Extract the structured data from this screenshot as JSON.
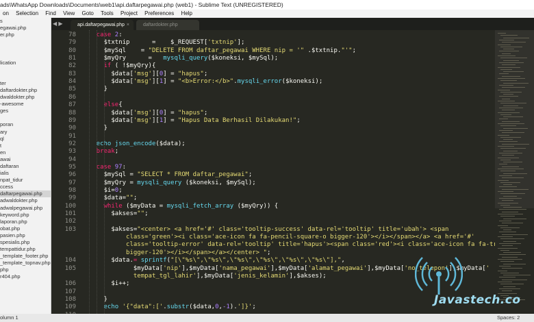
{
  "window": {
    "title": "ads\\WhatsApp Downloads\\Documents\\web1\\api.daftarpegawai.php (web1) - Sublime Text (UNREGISTERED)"
  },
  "menu": [
    "on",
    "Selection",
    "Find",
    "View",
    "Goto",
    "Tools",
    "Project",
    "Preferences",
    "Help"
  ],
  "sidebar": {
    "items": [
      "s",
      "egawai.php",
      "er.php",
      "",
      "",
      "",
      "lication",
      "",
      "",
      "ter",
      "daftardokter.php",
      "dwaldokter.php",
      "-awesome",
      "ges",
      "",
      "poran",
      "ary",
      "ql",
      "t",
      "en",
      "awai",
      "daftaran",
      "ialis",
      "npat_tidur",
      "ccess",
      "daftarpegawai.php",
      "adwaldokter.php",
      "adwalpegawai.php",
      "keyword.php",
      "laporan.php",
      "obat.php",
      "pasien.php",
      "spesialis.php",
      "tempattidur.php",
      "_template_footer.php",
      "_template_topnav.php",
      "php",
      "r404.php"
    ],
    "active_index": 25
  },
  "tabs": [
    {
      "label": "api.daftarpegawai.php",
      "active": true
    },
    {
      "label": "daftardokter.php",
      "active": false
    }
  ],
  "tab_close_glyph": "×",
  "nav_glyph": "◀ ▶",
  "code_lines": [
    {
      "num": "78",
      "indent": 2,
      "tokens": [
        [
          "k",
          "case "
        ],
        [
          "n",
          "2"
        ],
        [
          "v",
          ":"
        ]
      ]
    },
    {
      "num": "79",
      "indent": 3,
      "tokens": [
        [
          "v",
          "$txtnip      =    $_REQUEST["
        ],
        [
          "s",
          "'txtnip'"
        ],
        [
          "v",
          "];"
        ]
      ]
    },
    {
      "num": "80",
      "indent": 3,
      "tokens": [
        [
          "v",
          "$mySql    = "
        ],
        [
          "s",
          "\"DELETE FROM daftar_pegawai WHERE nip = '\""
        ],
        [
          "v",
          " ."
        ],
        [
          "v",
          "$txtnip."
        ],
        [
          "s",
          "\"'\""
        ],
        [
          "v",
          ";"
        ]
      ]
    },
    {
      "num": "81",
      "indent": 3,
      "tokens": [
        [
          "v",
          "$myQry      =   "
        ],
        [
          "f",
          "mysqli_query"
        ],
        [
          "v",
          "($koneksi, $mySql);"
        ]
      ]
    },
    {
      "num": "82",
      "indent": 3,
      "tokens": [
        [
          "k",
          "if "
        ],
        [
          "v",
          "( !"
        ],
        [
          "v",
          "$myQry){"
        ]
      ]
    },
    {
      "num": "83",
      "indent": 4,
      "tokens": [
        [
          "v",
          "$data["
        ],
        [
          "s",
          "'msg'"
        ],
        [
          "v",
          "]["
        ],
        [
          "n",
          "0"
        ],
        [
          "v",
          "] = "
        ],
        [
          "s",
          "\"hapus\""
        ],
        [
          "v",
          ";"
        ]
      ]
    },
    {
      "num": "84",
      "indent": 4,
      "tokens": [
        [
          "v",
          "$data["
        ],
        [
          "s",
          "'msg'"
        ],
        [
          "v",
          "]["
        ],
        [
          "n",
          "1"
        ],
        [
          "v",
          "] = "
        ],
        [
          "s",
          "\"<b>Error:</b>\""
        ],
        [
          "v",
          "."
        ],
        [
          "f",
          "mysqli_error"
        ],
        [
          "v",
          "($koneksi);"
        ]
      ]
    },
    {
      "num": "85",
      "indent": 3,
      "tokens": [
        [
          "v",
          "}"
        ]
      ]
    },
    {
      "num": "86",
      "indent": 0,
      "tokens": []
    },
    {
      "num": "87",
      "indent": 3,
      "tokens": [
        [
          "k",
          "else"
        ],
        [
          "v",
          "{"
        ]
      ]
    },
    {
      "num": "88",
      "indent": 4,
      "tokens": [
        [
          "v",
          "$data["
        ],
        [
          "s",
          "'msg'"
        ],
        [
          "v",
          "]["
        ],
        [
          "n",
          "0"
        ],
        [
          "v",
          "] = "
        ],
        [
          "s",
          "\"hapus\""
        ],
        [
          "v",
          ";"
        ]
      ]
    },
    {
      "num": "89",
      "indent": 4,
      "tokens": [
        [
          "v",
          "$data["
        ],
        [
          "s",
          "'msg'"
        ],
        [
          "v",
          "]["
        ],
        [
          "n",
          "1"
        ],
        [
          "v",
          "] = "
        ],
        [
          "s",
          "\"Hapus Data Berhasil Dilakukan!\""
        ],
        [
          "v",
          ";"
        ]
      ]
    },
    {
      "num": "90",
      "indent": 3,
      "tokens": [
        [
          "v",
          "}"
        ]
      ]
    },
    {
      "num": "91",
      "indent": 0,
      "tokens": []
    },
    {
      "num": "92",
      "indent": 2,
      "tokens": [
        [
          "f",
          "echo "
        ],
        [
          "f",
          "json_encode"
        ],
        [
          "v",
          "($data);"
        ]
      ]
    },
    {
      "num": "93",
      "indent": 2,
      "tokens": [
        [
          "k",
          "break"
        ],
        [
          "v",
          ";"
        ]
      ]
    },
    {
      "num": "94",
      "indent": 0,
      "tokens": []
    },
    {
      "num": "95",
      "indent": 2,
      "tokens": [
        [
          "k",
          "case "
        ],
        [
          "n",
          "97"
        ],
        [
          "v",
          ":"
        ]
      ]
    },
    {
      "num": "96",
      "indent": 3,
      "tokens": [
        [
          "v",
          "$mySql = "
        ],
        [
          "s",
          "\"SELECT * FROM daftar_pegawai\""
        ],
        [
          "v",
          ";"
        ]
      ]
    },
    {
      "num": "97",
      "indent": 3,
      "tokens": [
        [
          "v",
          "$myQry = "
        ],
        [
          "f",
          "mysqli_query "
        ],
        [
          "v",
          "($koneksi, $mySql);"
        ]
      ]
    },
    {
      "num": "98",
      "indent": 3,
      "tokens": [
        [
          "v",
          "$i="
        ],
        [
          "n",
          "0"
        ],
        [
          "v",
          ";"
        ]
      ]
    },
    {
      "num": "99",
      "indent": 3,
      "tokens": [
        [
          "v",
          "$data="
        ],
        [
          "s",
          "\"\""
        ],
        [
          "v",
          ";"
        ]
      ]
    },
    {
      "num": "100",
      "indent": 3,
      "tokens": [
        [
          "k",
          "while "
        ],
        [
          "v",
          "($myData = "
        ],
        [
          "f",
          "mysqli_fetch_array "
        ],
        [
          "v",
          "($myQry)) {"
        ]
      ]
    },
    {
      "num": "101",
      "indent": 4,
      "tokens": [
        [
          "v",
          "$akses="
        ],
        [
          "s",
          "\"\""
        ],
        [
          "v",
          ";"
        ]
      ]
    },
    {
      "num": "102",
      "indent": 0,
      "tokens": []
    },
    {
      "num": "103",
      "indent": 4,
      "tokens": [
        [
          "v",
          "$akses="
        ],
        [
          "s",
          "\"<center> <a href='#' class='tooltip-success' data-rel='tooltip' title='ubah'> <span"
        ]
      ]
    },
    {
      "num": "",
      "indent": 6,
      "tokens": [
        [
          "s",
          "class='green'><i class='ace-icon fa fa-pencil-square-o bigger-120'></i></span></a> <a href='#'"
        ]
      ]
    },
    {
      "num": "",
      "indent": 6,
      "tokens": [
        [
          "s",
          "class='tooltip-error' data-rel='tooltip' title='hapus'><span class='red'><i class='ace-icon fa fa-trash-o"
        ]
      ]
    },
    {
      "num": "",
      "indent": 6,
      "tokens": [
        [
          "s",
          "bigger-120'></i></span></a></center> \""
        ],
        [
          "v",
          ";"
        ]
      ]
    },
    {
      "num": "104",
      "indent": 4,
      "tokens": [
        [
          "v",
          "$data."
        ],
        [
          "o",
          "= "
        ],
        [
          "f",
          "sprintf"
        ],
        [
          "v",
          "("
        ],
        [
          "s",
          "\"[\\\"%s\\\",\\\"%s\\\",\\\"%s\\\",\\\"%s\\\",\\\"%s\\\",\\\"%s\\\"],\""
        ],
        [
          "v",
          ","
        ]
      ]
    },
    {
      "num": "105",
      "indent": 7,
      "tokens": [
        [
          "v",
          "$myData["
        ],
        [
          "s",
          "'nip'"
        ],
        [
          "v",
          "],$myData["
        ],
        [
          "s",
          "'nama_pegawai'"
        ],
        [
          "v",
          "],$myData["
        ],
        [
          "s",
          "'alamat_pegawai'"
        ],
        [
          "v",
          "],$myData["
        ],
        [
          "s",
          "'no_telepon'"
        ],
        [
          "v",
          "],$myData["
        ],
        [
          "s",
          "'"
        ]
      ]
    },
    {
      "num": "",
      "indent": 7,
      "tokens": [
        [
          "s",
          "tempat_tgl_lahir'"
        ],
        [
          "v",
          "],$myData["
        ],
        [
          "s",
          "'jenis_kelamin'"
        ],
        [
          "v",
          "],$akses);"
        ]
      ]
    },
    {
      "num": "106",
      "indent": 4,
      "tokens": [
        [
          "v",
          "$i++;"
        ]
      ]
    },
    {
      "num": "107",
      "indent": 0,
      "tokens": []
    },
    {
      "num": "108",
      "indent": 3,
      "tokens": [
        [
          "v",
          "}"
        ]
      ]
    },
    {
      "num": "109",
      "indent": 3,
      "tokens": [
        [
          "f",
          "echo "
        ],
        [
          "s",
          "'{\"data\":['"
        ],
        [
          "v",
          "."
        ],
        [
          "f",
          "substr"
        ],
        [
          "v",
          "($data,"
        ],
        [
          "n",
          "0"
        ],
        [
          "v",
          ","
        ],
        [
          "n",
          "-1"
        ],
        [
          "v",
          ")."
        ],
        [
          "s",
          "']}'"
        ],
        [
          "v",
          ";"
        ]
      ]
    },
    {
      "num": "110",
      "indent": 2,
      "tokens": []
    }
  ],
  "colors": {
    "keyword": "#f92672",
    "string": "#e6db74",
    "function": "#66d9ef",
    "number": "#ae81ff",
    "text": "#f8f8f2",
    "line_number": "#90908a",
    "background": "#272822"
  },
  "watermark": {
    "text": "Javastech.co",
    "icon": "wifi-broadcast-icon"
  },
  "status": {
    "left": "olumn 1",
    "right": "Spaces: 2"
  }
}
